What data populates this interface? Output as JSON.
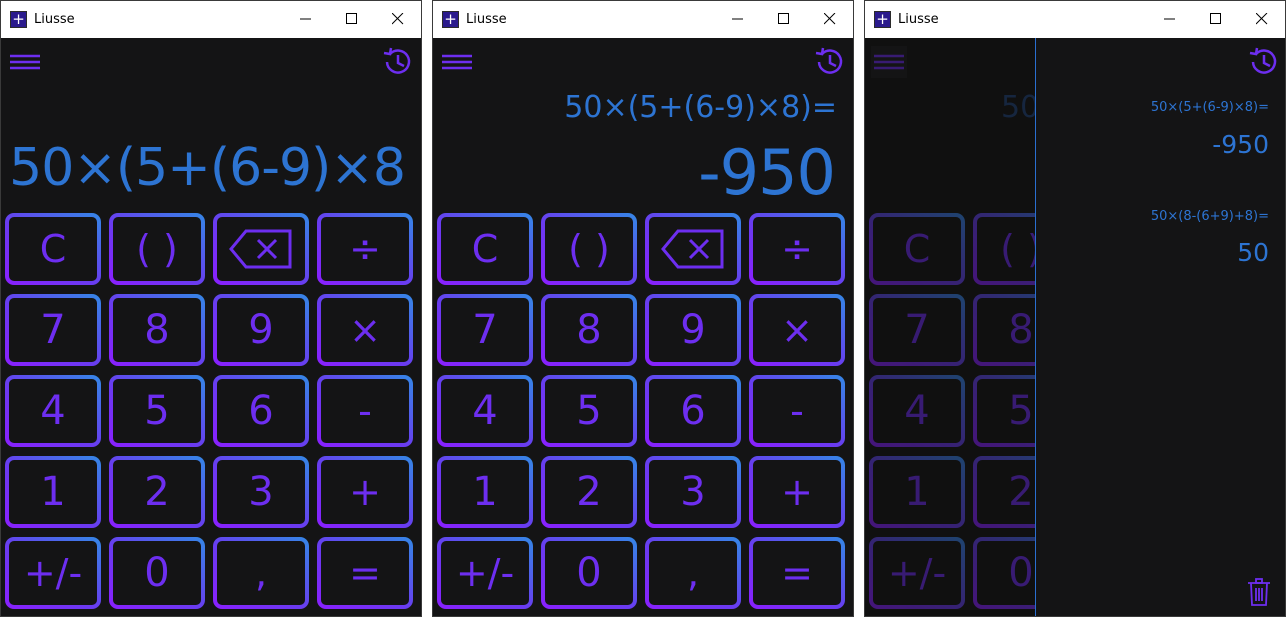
{
  "app_title": "Liusse",
  "colors": {
    "accent_blue": "#2d74d2",
    "key_purple": "#6d2ef0",
    "background": "#141415"
  },
  "keys": [
    [
      "C",
      "( )",
      "backspace-icon",
      "÷"
    ],
    [
      "7",
      "8",
      "9",
      "×"
    ],
    [
      "4",
      "5",
      "6",
      "-"
    ],
    [
      "1",
      "2",
      "3",
      "+"
    ],
    [
      "+/-",
      "0",
      ",",
      "="
    ]
  ],
  "window1": {
    "expression": "50×(5+(6-9)×8"
  },
  "window2": {
    "expression": "50×(5+(6-9)×8)=",
    "result": "-950"
  },
  "window3": {
    "partial_expression": "50",
    "history": [
      {
        "expression": "50×(5+(6-9)×8)=",
        "result": "-950"
      },
      {
        "expression": "50×(8-(6+9)+8)=",
        "result": "50"
      }
    ]
  }
}
